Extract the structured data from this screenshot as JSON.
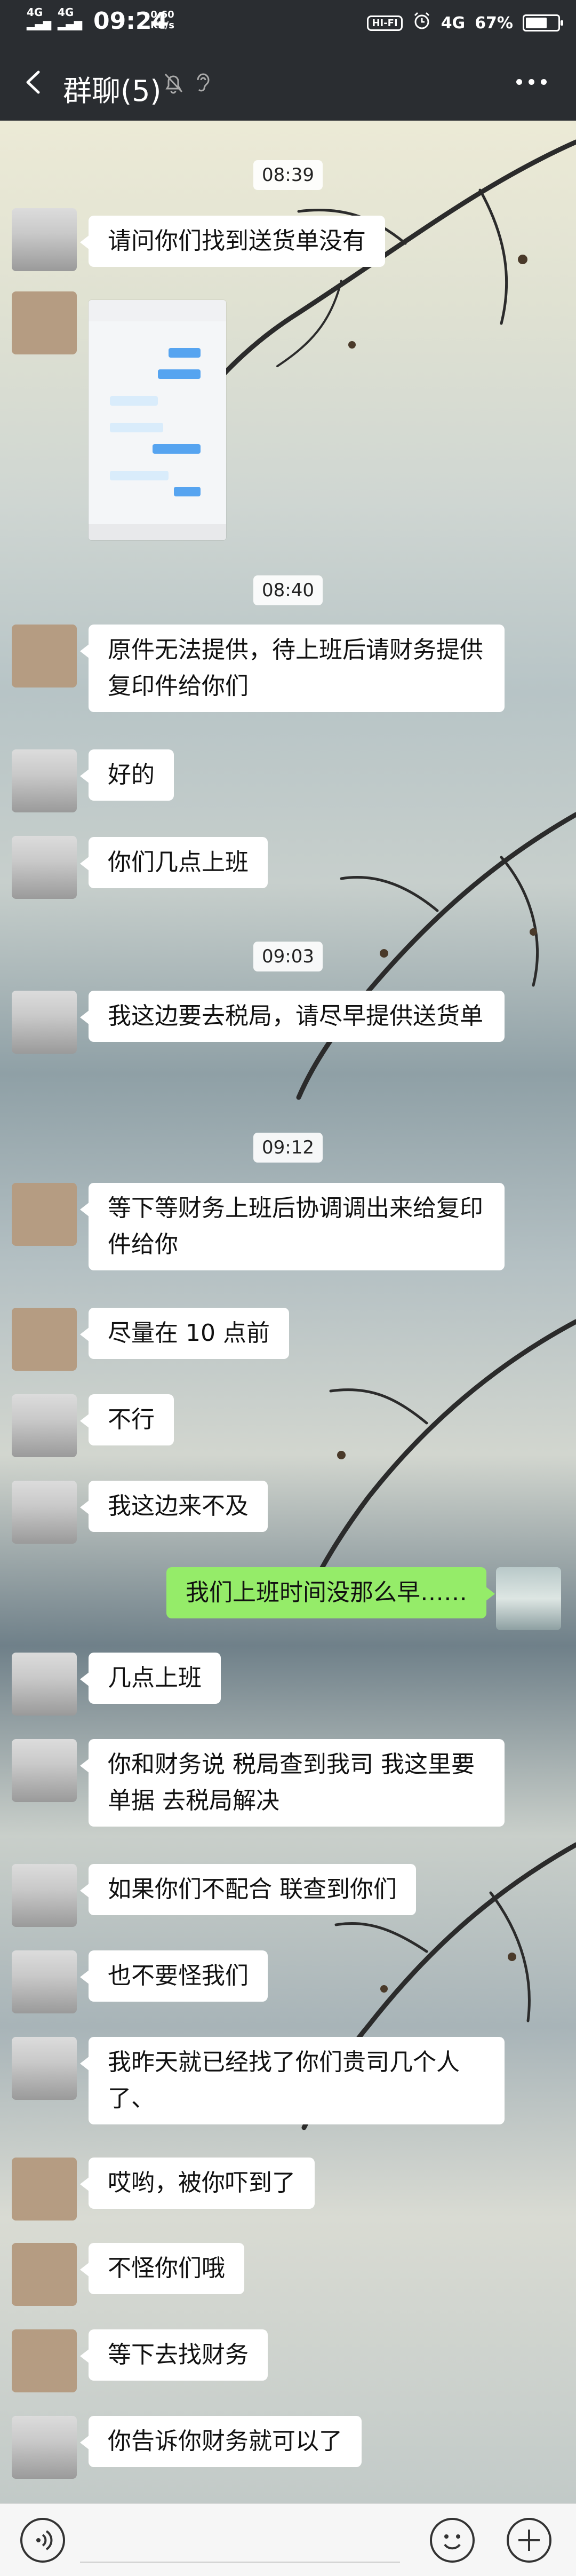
{
  "status_bar": {
    "signal1": "4G",
    "signal2": "4G",
    "time": "09:24",
    "speed_value": "0.60",
    "speed_unit": "KB/s",
    "hifi": "HI-FI",
    "network": "4G",
    "battery_percent": "67%",
    "battery_level": 0.67
  },
  "title_bar": {
    "title": "群聊(5)"
  },
  "chat": {
    "time_labels": [
      "08:39",
      "08:40",
      "09:03",
      "09:12"
    ],
    "messages": [
      {
        "text": "请问你们找到送货单没有"
      },
      {
        "text": "原件无法提供，待上班后请财务提供复印件给你们"
      },
      {
        "text": "好的"
      },
      {
        "text": "你们几点上班"
      },
      {
        "text": "我这边要去税局，请尽早提供送货单"
      },
      {
        "text": "等下等财务上班后协调调出来给复印件给你"
      },
      {
        "text": "尽量在 10 点前"
      },
      {
        "text": "不行"
      },
      {
        "text": "我这边来不及"
      },
      {
        "text": "我们上班时间没那么早……"
      },
      {
        "text": "几点上班"
      },
      {
        "text": "你和财务说  税局查到我司   我这里要单据  去税局解决"
      },
      {
        "text": "如果你们不配合  联查到你们"
      },
      {
        "text": "也不要怪我们"
      },
      {
        "text": "我昨天就已经找了你们贵司几个人了、"
      },
      {
        "text": "哎哟，被你吓到了"
      },
      {
        "text": "不怪你们哦"
      },
      {
        "text": "等下去找财务"
      },
      {
        "text": "你告诉你财务就可以了"
      }
    ]
  },
  "input_bar": {
    "placeholder": ""
  }
}
